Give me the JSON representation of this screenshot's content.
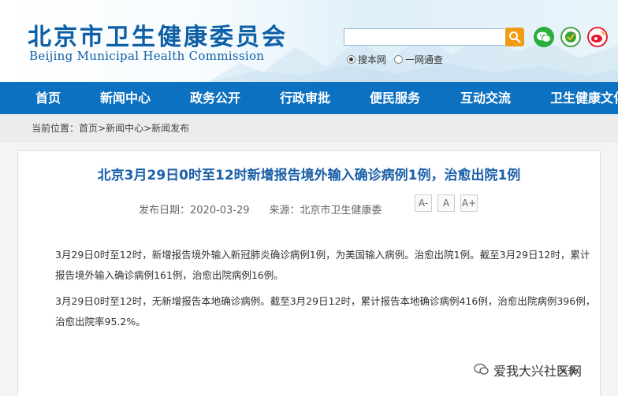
{
  "header": {
    "logo_cn": "北京市卫生健康委员会",
    "logo_en": "Beijing Municipal Health Commission",
    "search": {
      "value": "",
      "placeholder": ""
    },
    "radio_options": [
      {
        "label": "搜本网",
        "selected": true
      },
      {
        "label": "一网通查",
        "selected": false
      }
    ],
    "social_icons": [
      "wechat-icon",
      "health-app-icon",
      "weibo-icon"
    ],
    "colors": {
      "brand_blue": "#0d5fa6",
      "search_button": "#f29b16"
    }
  },
  "nav": {
    "items": [
      "首页",
      "新闻中心",
      "政务公开",
      "行政审批",
      "便民服务",
      "互动交流",
      "卫生健康文化"
    ],
    "color": "#0d71c1"
  },
  "breadcrumb": {
    "label": "当前位置：",
    "items": [
      "首页",
      "新闻中心",
      "新闻发布"
    ],
    "separator": ">"
  },
  "article": {
    "title": "北京3月29日0时至12时新增报告境外输入确诊病例1例，治愈出院1例",
    "date_label": "发布日期：",
    "date": "2020-03-29",
    "source_label": "来源：",
    "source": "北京市卫生健康委",
    "font_buttons": [
      "A-",
      "A",
      "A+"
    ],
    "paragraphs": [
      "3月29日0时至12时，新增报告境外输入新冠肺炎确诊病例1例，为美国输入病例。治愈出院1例。截至3月29日12时，累计报告境外输入确诊病例161例，治愈出院病例16例。",
      "3月29日0时至12时，无新增报告本地确诊病例。截至3月29日12时，累计报告本地确诊病例416例，治愈出院病例396例，治愈出院率95.2%。"
    ]
  },
  "watermark": {
    "text": "爱我大兴社区网",
    "sub": "头条"
  }
}
